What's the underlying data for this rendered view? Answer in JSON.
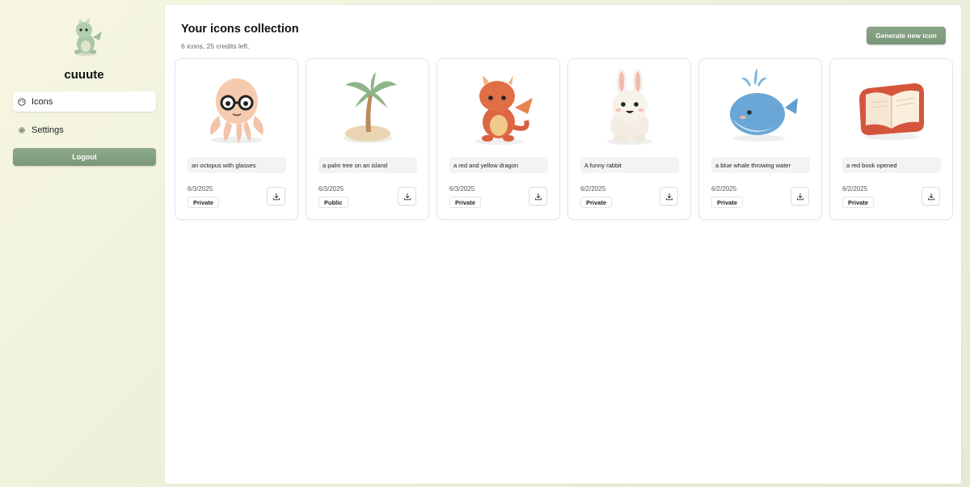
{
  "sidebar": {
    "brand": "cuuute",
    "logo_icon": "dragon-mascot-icon",
    "nav": [
      {
        "label": "Icons",
        "icon": "palette-icon",
        "active": true
      },
      {
        "label": "Settings",
        "icon": "gear-icon",
        "active": false
      }
    ],
    "logout_label": "Logout"
  },
  "header": {
    "title": "Your icons collection",
    "subtitle": "6 icons, 25 credits left.",
    "generate_label": "Generate new icon"
  },
  "colors": {
    "accent": "#7e9c7d",
    "page_bg": "#eef2dc"
  },
  "icons": [
    {
      "art": "octopus-glasses-icon",
      "description": "an octopus with glasses",
      "date": "6/3/2025",
      "visibility": "Private"
    },
    {
      "art": "palm-tree-island-icon",
      "description": "a palm tree on an island",
      "date": "6/3/2025",
      "visibility": "Public"
    },
    {
      "art": "red-dragon-icon",
      "description": "a red and yellow dragon",
      "date": "6/3/2025",
      "visibility": "Private"
    },
    {
      "art": "rabbit-icon",
      "description": "A funny rabbit",
      "date": "6/2/2025",
      "visibility": "Private"
    },
    {
      "art": "blue-whale-icon",
      "description": "a blue whale throwing water",
      "date": "6/2/2025",
      "visibility": "Private"
    },
    {
      "art": "red-book-icon",
      "description": "a red book opened",
      "date": "6/2/2025",
      "visibility": "Private"
    }
  ]
}
